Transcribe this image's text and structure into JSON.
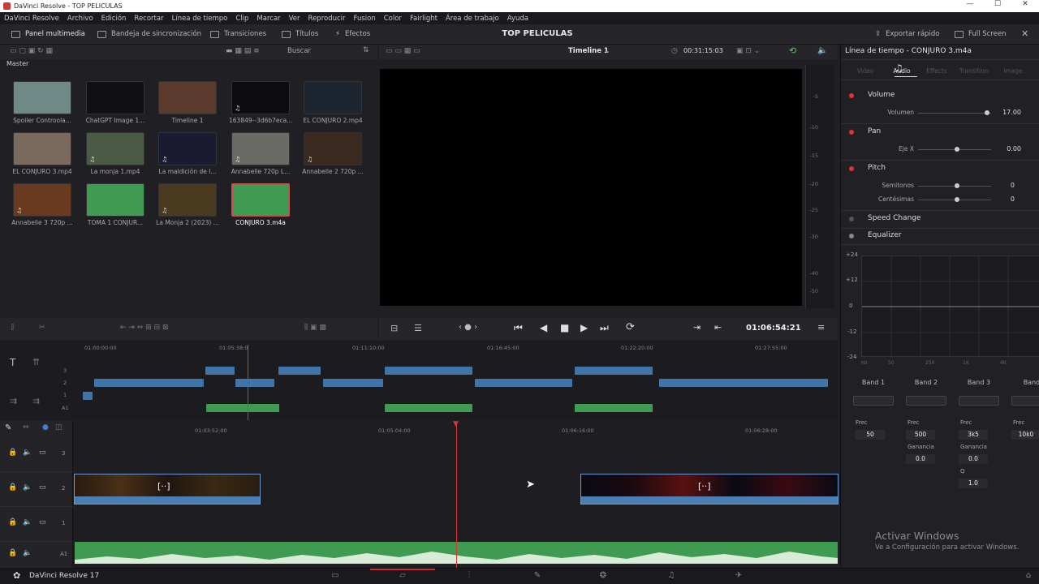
{
  "window": {
    "title": "DaVinci Resolve - TOP PELICULAS",
    "controls": [
      "—",
      "☐",
      "✕"
    ]
  },
  "menu": [
    "DaVinci Resolve",
    "Archivo",
    "Edición",
    "Recortar",
    "Línea de tiempo",
    "Clip",
    "Marcar",
    "Ver",
    "Reproducir",
    "Fusion",
    "Color",
    "Fairlight",
    "Área de trabajo",
    "Ayuda"
  ],
  "toolbar": {
    "panel_multimedia": "Panel multimedia",
    "bandeja": "Bandeja de sincronización",
    "transiciones": "Transiciones",
    "titulos": "Títulos",
    "efectos": "Efectos",
    "project_title": "TOP PELICULAS",
    "exportar": "Exportar rápido",
    "fullscreen": "Full Screen"
  },
  "mediapool": {
    "search_placeholder": "Buscar",
    "bin": "Master",
    "clips": [
      {
        "label": "Spoiler Controola...",
        "color": "#6f8a86",
        "icon": ""
      },
      {
        "label": "ChatGPT Image 1...",
        "color": "#101015",
        "icon": ""
      },
      {
        "label": "Timeline 1",
        "color": "#5a3a2c",
        "icon": ""
      },
      {
        "label": "163849--3d6b7eca...",
        "color": "#0c0c10",
        "icon": "♫"
      },
      {
        "label": "EL CONJURO 2.mp4",
        "color": "#1c2530",
        "icon": ""
      },
      {
        "label": "EL CONJURO 3.mp4",
        "color": "#7a6a5e",
        "icon": ""
      },
      {
        "label": "La monja 1.mp4",
        "color": "#4a5a44",
        "icon": "♫"
      },
      {
        "label": "La maldición de l...",
        "color": "#1a1a30",
        "icon": "♫"
      },
      {
        "label": "Annabelle 720p L...",
        "color": "#6a6a66",
        "icon": "♫"
      },
      {
        "label": "Annabelle 2 720p ...",
        "color": "#3a2a20",
        "icon": "♫"
      },
      {
        "label": "Annabelle 3 720p ...",
        "color": "#6a3a20",
        "icon": "♫"
      },
      {
        "label": "TOMA 1 CONJUR...",
        "color": "#3f9a52",
        "icon": ""
      },
      {
        "label": "La Monja 2 (2023) ...",
        "color": "#4a3a20",
        "icon": "♫"
      },
      {
        "label": "CONJURO 3.m4a",
        "color": "#3f9a52",
        "icon": "",
        "selected": true
      }
    ]
  },
  "viewer": {
    "timeline_name": "Timeline 1",
    "timecode_top": "00:31:15:03",
    "timecode": "01:06:54:21"
  },
  "meter": {
    "ticks": [
      "-5",
      "-10",
      "-15",
      "-20",
      "-25",
      "-30",
      "-40",
      "-50"
    ]
  },
  "inspector": {
    "title": "Línea de tiempo - CONJURO 3.m4a",
    "tabs": [
      "Video",
      "Audio",
      "Effects",
      "Transition",
      "Image"
    ],
    "active_tab": "Audio",
    "volume": {
      "title": "Volume",
      "param": "Volumen",
      "value": "17.00"
    },
    "pan": {
      "title": "Pan",
      "param": "Eje X",
      "value": "0.00"
    },
    "pitch": {
      "title": "Pitch",
      "p1": "Semitonos",
      "v1": "0",
      "p2": "Centésimas",
      "v2": "0"
    },
    "speed": {
      "title": "Speed Change"
    },
    "eq": {
      "title": "Equalizer",
      "yticks": [
        "+24",
        "+12",
        "0",
        "-12",
        "-24"
      ],
      "xticks": [
        "Hz",
        "50",
        "250",
        "1K",
        "4K"
      ]
    },
    "bands": [
      {
        "name": "Band 1",
        "frec_label": "Frec",
        "frec": "50"
      },
      {
        "name": "Band 2",
        "frec_label": "Frec",
        "frec": "500",
        "gain_label": "Ganancia",
        "gain": "0.0"
      },
      {
        "name": "Band 3",
        "frec_label": "Frec",
        "frec": "3k5",
        "gain_label": "Ganancia",
        "gain": "0.0",
        "q_label": "Q",
        "q": "1.0"
      },
      {
        "name": "Band",
        "frec_label": "Frec",
        "frec": "10k0"
      }
    ],
    "watermark_title": "Activar Windows",
    "watermark_sub": "Ve a Configuración para activar Windows."
  },
  "timeline": {
    "mini_ruler": [
      "01:00:00:00",
      "01:05:38:0",
      "01:11:10:00",
      "01:16:45:00",
      "01:22:20:00",
      "01:27:55:00"
    ],
    "main_ruler": [
      "01:03:52:00",
      "01:05:04:00",
      "01:06:16:00",
      "01:06:28:00"
    ],
    "mini_tracks": [
      "3",
      "2",
      "1",
      "A1"
    ],
    "tracks": [
      {
        "num": "3"
      },
      {
        "num": "2"
      },
      {
        "num": "1"
      },
      {
        "num": "A1"
      }
    ]
  },
  "pagebar": {
    "app": "DaVinci Resolve 17"
  }
}
